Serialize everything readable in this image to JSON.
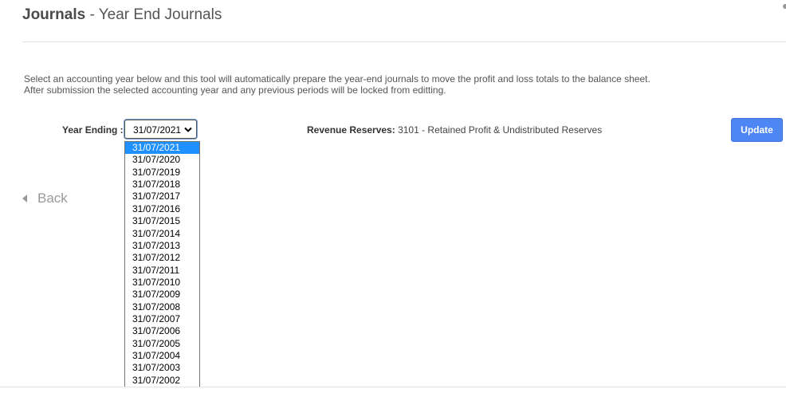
{
  "header": {
    "title_bold": "Journals",
    "title_rest": " - Year End Journals"
  },
  "description": {
    "line1": "Select an accounting year below and this tool will automatically prepare the year-end journals to move the profit and loss totals to the balance sheet.",
    "line2": "After submission the selected accounting year and any previous periods will be locked from editting."
  },
  "form": {
    "year_ending_label": "Year Ending :",
    "year_ending_selected": "31/07/2021",
    "year_options": [
      "31/07/2021",
      "31/07/2020",
      "31/07/2019",
      "31/07/2018",
      "31/07/2017",
      "31/07/2016",
      "31/07/2015",
      "31/07/2014",
      "31/07/2013",
      "31/07/2012",
      "31/07/2011",
      "31/07/2010",
      "31/07/2009",
      "31/07/2008",
      "31/07/2007",
      "31/07/2006",
      "31/07/2005",
      "31/07/2004",
      "31/07/2003",
      "31/07/2002"
    ],
    "revenue_reserves_label": "Revenue Reserves:",
    "revenue_reserves_value": " 3101 - Retained Profit & Undistributed Reserves",
    "update_label": "Update"
  },
  "nav": {
    "back_label": "Back"
  },
  "colors": {
    "accent": "#4e86f4",
    "selected_option": "#1e90ff"
  }
}
